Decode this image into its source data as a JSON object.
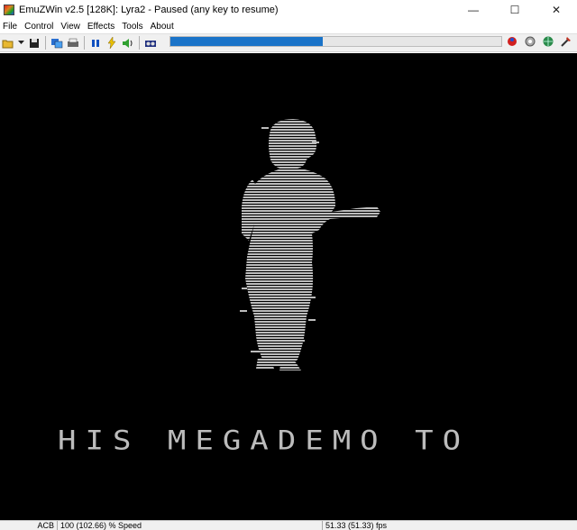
{
  "window": {
    "title": "EmuZWin v2.5 [128K]: Lyra2 - Paused (any key to resume)",
    "controls": {
      "minimize": "—",
      "maximize": "☐",
      "close": "✕"
    }
  },
  "menu": [
    "File",
    "Control",
    "View",
    "Effects",
    "Tools",
    "About"
  ],
  "toolbar": {
    "left_icons": [
      "open-icon",
      "dropdown-icon",
      "save-icon",
      "snapshot-icon",
      "print-icon",
      "pause-icon",
      "turbo-icon",
      "sound-icon",
      "tape-icon"
    ],
    "right_icons": [
      "bug-icon",
      "settings-icon",
      "globe-icon",
      "tools-icon"
    ],
    "progress": 0.46
  },
  "screen": {
    "background": "#000000",
    "figure_color": "#bcbcbc",
    "demo_text": "HIS MEGADEMO TO"
  },
  "status": {
    "segment1": "ACB",
    "speed": "100 (102.66) % Speed",
    "fps": "51.33 (51.33) fps"
  }
}
